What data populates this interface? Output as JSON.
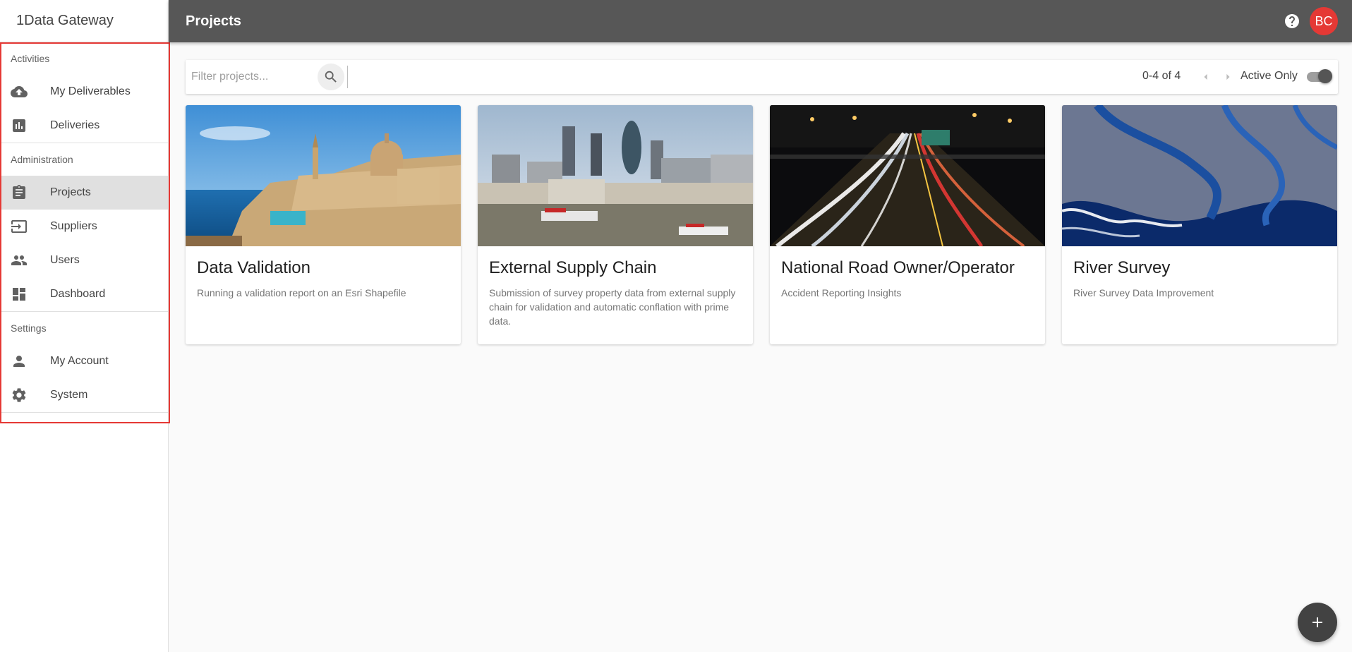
{
  "app": {
    "title": "1Data Gateway"
  },
  "header": {
    "title": "Projects",
    "avatar_initials": "BC",
    "help_icon": "help-circle-icon"
  },
  "sidebar": {
    "sections": [
      {
        "header": "Activities",
        "items": [
          {
            "label": "My Deliverables",
            "icon": "cloud-upload-icon"
          },
          {
            "label": "Deliveries",
            "icon": "bar-chart-icon"
          }
        ]
      },
      {
        "header": "Administration",
        "items": [
          {
            "label": "Projects",
            "icon": "clipboard-icon",
            "active": true
          },
          {
            "label": "Suppliers",
            "icon": "input-icon"
          },
          {
            "label": "Users",
            "icon": "people-icon"
          },
          {
            "label": "Dashboard",
            "icon": "dashboard-icon"
          }
        ]
      },
      {
        "header": "Settings",
        "items": [
          {
            "label": "My Account",
            "icon": "person-icon"
          },
          {
            "label": "System",
            "icon": "gear-icon"
          }
        ]
      }
    ]
  },
  "toolbar": {
    "filter_placeholder": "Filter projects...",
    "filter_value": "",
    "page_range": "0-4 of 4",
    "active_only_label": "Active Only",
    "active_only": true
  },
  "projects": [
    {
      "title": "Data Validation",
      "description": "Running a validation report on an Esri Shapefile",
      "image": "harbor-city-photo"
    },
    {
      "title": "External Supply Chain",
      "description": "Submission of survey property data from external supply chain for validation and automatic conflation with prime data.",
      "image": "city-skyline-photo"
    },
    {
      "title": "National Road Owner/Operator",
      "description": "Accident Reporting Insights",
      "image": "highway-night-photo"
    },
    {
      "title": "River Survey",
      "description": "River Survey Data Improvement",
      "image": "river-aerial-photo"
    }
  ],
  "colors": {
    "header_bg": "#575757",
    "avatar_bg": "#e53935",
    "highlight_outline": "#e53935",
    "fab_bg": "#424242"
  }
}
